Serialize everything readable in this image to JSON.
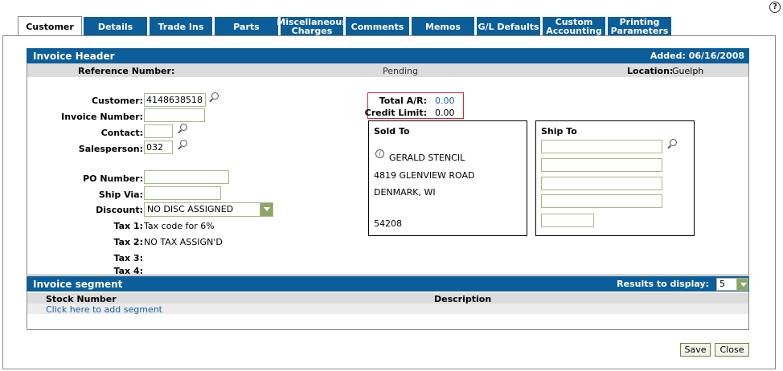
{
  "tabs": [
    {
      "label": "Customer",
      "active": true
    },
    {
      "label": "Details"
    },
    {
      "label": "Trade Ins"
    },
    {
      "label": "Parts"
    },
    {
      "label": "Miscellaneous Charges"
    },
    {
      "label": "Comments"
    },
    {
      "label": "Memos"
    },
    {
      "label": "G/L Defaults"
    },
    {
      "label": "Custom Accounting"
    },
    {
      "label": "Printing Parameters"
    }
  ],
  "header": {
    "title": "Invoice Header",
    "added": "Added: 06/16/2008",
    "reference_label": "Reference Number:",
    "status": "Pending",
    "location_label": "Location:",
    "location_value": "Guelph"
  },
  "form": {
    "customer_label": "Customer:",
    "customer_value": "4148638518",
    "invoice_label": "Invoice Number:",
    "invoice_value": "",
    "contact_label": "Contact:",
    "contact_value": "",
    "salesperson_label": "Salesperson:",
    "salesperson_value": "032",
    "po_label": "PO Number:",
    "po_value": "",
    "shipvia_label": "Ship Via:",
    "shipvia_value": "",
    "discount_label": "Discount:",
    "discount_value": "NO DISC ASSIGNED",
    "tax1_label": "Tax 1:",
    "tax1_value": "Tax code for 6%",
    "tax2_label": "Tax 2:",
    "tax2_value": "NO TAX ASSIGN'D",
    "tax3_label": "Tax 3:",
    "tax4_label": "Tax 4:"
  },
  "ar": {
    "total_label": "Total A/R:",
    "total_value": "0.00",
    "credit_label": "Credit Limit:",
    "credit_value": "0.00"
  },
  "sold_to": {
    "title": "Sold To",
    "name": "GERALD STENCIL",
    "address": "4819 GLENVIEW ROAD",
    "city": "DENMARK, WI",
    "zip": "54208"
  },
  "ship_to": {
    "title": "Ship To",
    "line1": "",
    "line2": "",
    "line3": "",
    "line4": "",
    "zip": ""
  },
  "segment": {
    "title": "Invoice segment",
    "results_label": "Results to display:",
    "results_value": "5",
    "col_stock": "Stock Number",
    "col_desc": "Description",
    "add_link": "Click here to add segment"
  },
  "buttons": {
    "save": "Save",
    "close": "Close"
  }
}
